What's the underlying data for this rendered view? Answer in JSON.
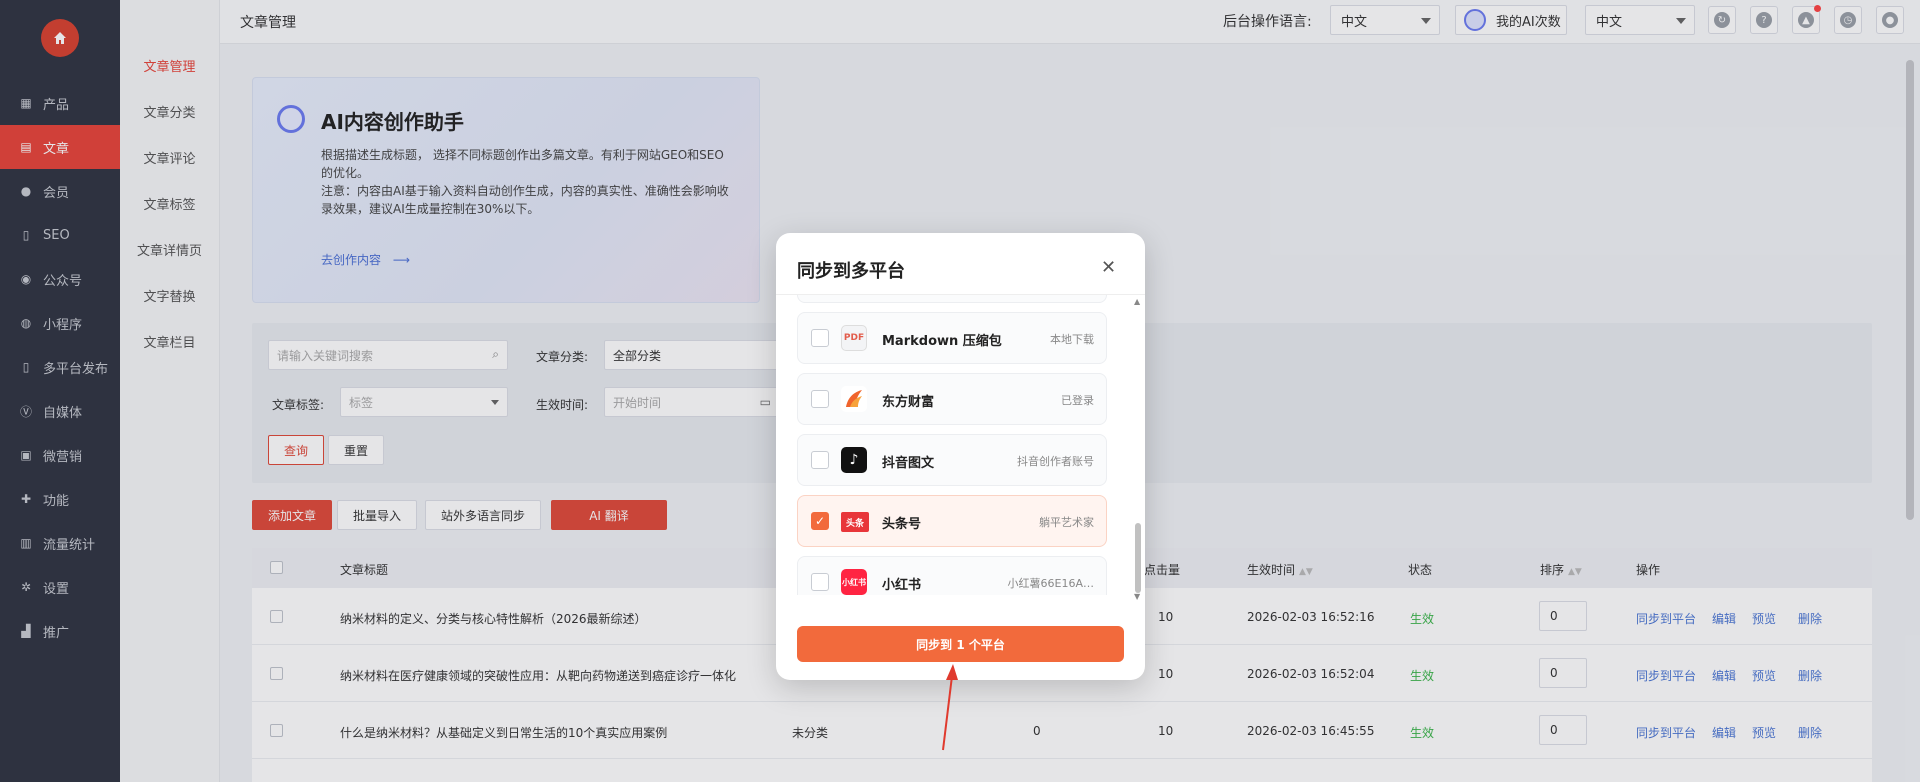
{
  "sidebar": {
    "items": [
      {
        "label": "产品",
        "icon": "grid-icon"
      },
      {
        "label": "文章",
        "icon": "article-icon",
        "active": true
      },
      {
        "label": "会员",
        "icon": "user-icon"
      },
      {
        "label": "SEO",
        "icon": "doc-icon"
      },
      {
        "label": "公众号",
        "icon": "wechat-icon"
      },
      {
        "label": "小程序",
        "icon": "miniapp-icon"
      },
      {
        "label": "多平台发布",
        "icon": "doc-icon"
      },
      {
        "label": "自媒体",
        "icon": "media-icon"
      },
      {
        "label": "微营销",
        "icon": "gift-icon"
      },
      {
        "label": "功能",
        "icon": "puzzle-icon"
      },
      {
        "label": "流量统计",
        "icon": "bar-chart-icon"
      },
      {
        "label": "设置",
        "icon": "gear-icon"
      },
      {
        "label": "推广",
        "icon": "chart-icon"
      }
    ]
  },
  "subnav": {
    "items": [
      "文章管理",
      "文章分类",
      "文章评论",
      "文章标签",
      "文章详情页",
      "文字替换",
      "文章栏目"
    ]
  },
  "topbar": {
    "title": "文章管理",
    "lang_label": "后台操作语言:",
    "lang_value": "中文",
    "ai_count": "我的AI次数",
    "lang2_value": "中文"
  },
  "ai_card": {
    "title": "AI内容创作助手",
    "desc1": "根据描述生成标题， 选择不同标题创作出多篇文章。有利于网站GEO和SEO的优化。",
    "desc2": "注意：内容由AI基于输入资料自动创作生成，内容的真实性、准确性会影响收录效果，建议AI生成量控制在30%以下。",
    "link": "去创作内容"
  },
  "filter": {
    "keyword_placeholder": "请输入关键词搜索",
    "category_label": "文章分类:",
    "category_value": "全部分类",
    "tag_label": "文章标签:",
    "tag_placeholder": "标签",
    "time_label": "生效时间:",
    "time_placeholder": "开始时间",
    "query": "查询",
    "reset": "重置"
  },
  "actions": {
    "add": "添加文章",
    "import": "批量导入",
    "sync_lang": "站外多语言同步",
    "ai_translate": "AI 翻译"
  },
  "table": {
    "headers": {
      "title": "文章标题",
      "clicks": "点击量",
      "time": "生效时间",
      "status": "状态",
      "order": "排序",
      "ops": "操作"
    },
    "rows": [
      {
        "title": "纳米材料的定义、分类与核心特性解析（2026最新综述）",
        "category": "",
        "views": "",
        "clicks": "10",
        "time": "2026-02-03 16:52:16",
        "status": "生效",
        "order": "0"
      },
      {
        "title": "纳米材料在医疗健康领域的突破性应用：从靶向药物递送到癌症诊疗一体化",
        "category": "",
        "views": "",
        "clicks": "10",
        "time": "2026-02-03 16:52:04",
        "status": "生效",
        "order": "0"
      },
      {
        "title": "什么是纳米材料？从基础定义到日常生活的10个真实应用案例",
        "category": "未分类",
        "views": "0",
        "clicks": "10",
        "time": "2026-02-03 16:45:55",
        "status": "生效",
        "order": "0"
      }
    ],
    "row_actions": [
      "同步到平台",
      "编辑",
      "预览",
      "删除"
    ]
  },
  "modal": {
    "title": "同步到多平台",
    "platforms": [
      {
        "name": "Markdown 压缩包",
        "status": "本地下载",
        "checked": false,
        "logo": "PDF",
        "color": "#f3f4f6"
      },
      {
        "name": "东方财富",
        "status": "已登录",
        "checked": false,
        "logo": "",
        "color": "#ffffff"
      },
      {
        "name": "抖音图文",
        "status": "抖音创作者账号",
        "checked": false,
        "logo": "♪",
        "color": "#111111"
      },
      {
        "name": "头条号",
        "status": "躺平艺术家",
        "checked": true,
        "logo": "头条",
        "color": "#e8363a"
      },
      {
        "name": "小红书",
        "status": "小红薯66E16A…",
        "checked": false,
        "logo": "小红书",
        "color": "#ff2442"
      }
    ],
    "sync_button": "同步到 1 个平台"
  }
}
